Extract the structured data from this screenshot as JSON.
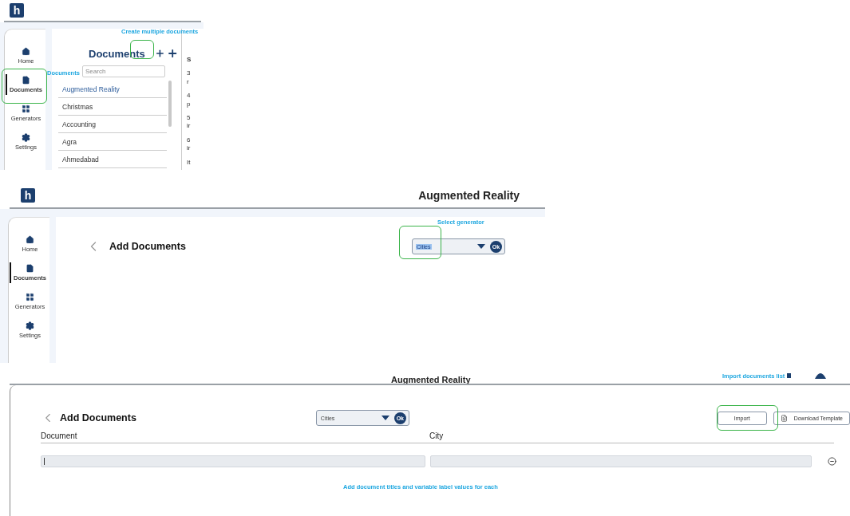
{
  "panels": [
    {
      "kind": "list_view",
      "header": {
        "logo": "h"
      },
      "nav": [
        {
          "label": "Home",
          "selected": false
        },
        {
          "label": "Documents",
          "selected": true
        },
        {
          "label": "Generators",
          "selected": false
        },
        {
          "label": "Settings",
          "selected": false
        }
      ],
      "documents": {
        "title": "Documents",
        "search": {
          "placeholder": "Search"
        },
        "items": [
          {
            "label": "Augmented Reality",
            "selected": true
          },
          {
            "label": "Christmas",
            "selected": false
          },
          {
            "label": "Accounting",
            "selected": false
          },
          {
            "label": "Agra",
            "selected": false
          },
          {
            "label": "Ahmedabad",
            "selected": false
          }
        ]
      },
      "preview_fragments": [
        "S",
        "3",
        "r",
        "4",
        "p",
        "5",
        "ir",
        "6",
        "ir",
        "It"
      ],
      "annotations": [
        "Create multiple documents",
        "Documents"
      ]
    },
    {
      "kind": "add_empty",
      "header": {
        "logo": "h",
        "title": "Augmented Reality"
      },
      "nav": [
        {
          "label": "Home",
          "selected": false
        },
        {
          "label": "Documents",
          "selected": true
        },
        {
          "label": "Generators",
          "selected": false
        },
        {
          "label": "Settings",
          "selected": false
        }
      ],
      "page_title": "Add Documents",
      "generator": {
        "value": "Cities",
        "text_selected": true,
        "ok": "Ok"
      },
      "annotations": [
        "Select generator"
      ]
    },
    {
      "kind": "add_table",
      "header": {
        "title": "Augmented Reality"
      },
      "page_title": "Add Documents",
      "generator": {
        "value": "Cities",
        "text_selected": false,
        "ok": "Ok"
      },
      "buttons": [
        {
          "label": "Import"
        },
        {
          "label": "Download Template"
        }
      ],
      "columns": [
        "Document",
        "City"
      ],
      "rows": [
        {
          "focused": true
        }
      ],
      "annotations": [
        "Import documents list",
        "Add document titles and variable label values for each"
      ]
    }
  ]
}
